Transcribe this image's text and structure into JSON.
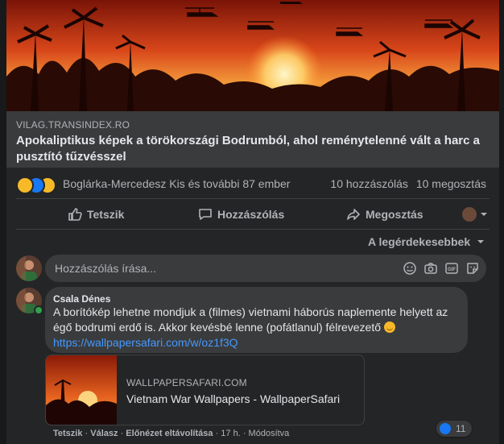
{
  "link": {
    "domain": "VILAG.TRANSINDEX.RO",
    "title": "Apokaliptikus képek a törökországi Bodrumból, ahol reménytelenné vált a harc a pusztító tűzvésszel"
  },
  "reactions": {
    "names": "Boglárka-Mercedesz Kis és további 87 ember",
    "comments": "10 hozzászólás",
    "shares": "10 megosztás",
    "icons": [
      "sad-icon",
      "like-icon",
      "wow-icon"
    ]
  },
  "actions": {
    "like": "Tetszik",
    "comment": "Hozzászólás",
    "share": "Megosztás"
  },
  "sort_label": "A legérdekesebbek",
  "comment_input": {
    "placeholder": "Hozzászólás írása..."
  },
  "comment": {
    "author": "Csala Dénes",
    "text": "A borítókép lehetne mondjuk a (filmes) vietnami háborús naplemente helyett az égő bodrumi erdő is. Akkor kevésbé lenne (pofátlanul) félrevezető",
    "link": "https://wallpapersafari.com/w/oz1f3Q",
    "preview": {
      "domain": "WALLPAPERSAFARI.COM",
      "title": "Vietnam War Wallpapers - WallpaperSafari"
    },
    "meta": {
      "like": "Tetszik",
      "reply": "Válasz",
      "remove_preview": "Előnézet eltávolítása",
      "time": "17 h.",
      "edited": "Módosítva"
    },
    "like_count": "11"
  },
  "colors": {
    "background": "#18191a",
    "card": "#242526",
    "surface": "#3a3b3c",
    "link": "#4599ff",
    "like_blue": "#1877f2"
  }
}
